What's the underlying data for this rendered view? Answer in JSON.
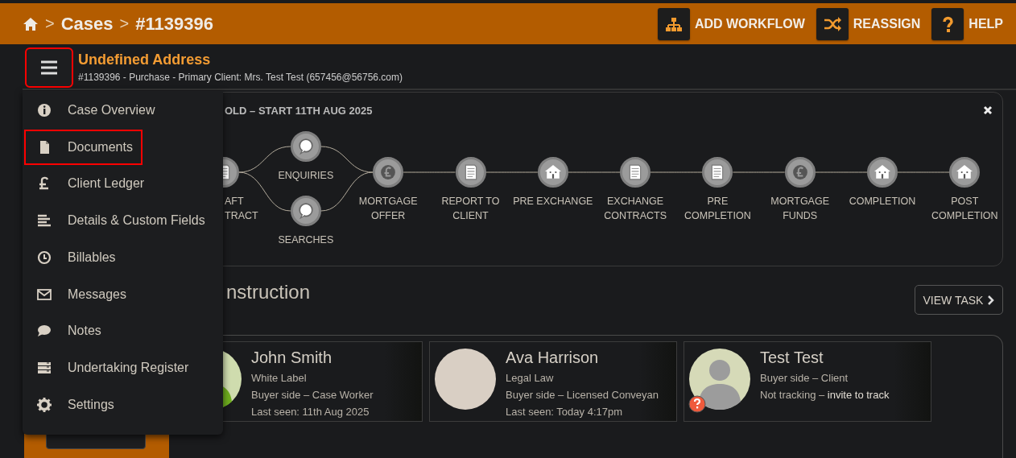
{
  "top_bar": {
    "breadcrumb": {
      "separator": ">",
      "items": [
        "Cases",
        "#1139396"
      ]
    },
    "actions": [
      {
        "label": "ADD WORKFLOW",
        "kind": "workflow"
      },
      {
        "label": "REASSIGN",
        "kind": "shuffle"
      },
      {
        "label": "HELP",
        "kind": "help"
      }
    ]
  },
  "case_header": {
    "menu_button_highlighted": true,
    "title": "Undefined Address",
    "subtitle": "#1139396 - Purchase - Primary Client: Mrs. Test Test (657456@56756.com)"
  },
  "workflow": {
    "title": "OLD – START 11TH AUG 2025",
    "stages": [
      {
        "steps": [
          {
            "label": "AFT TRACT",
            "kind": "document"
          }
        ]
      },
      {
        "steps": [
          {
            "label": "ENQUIRIES",
            "kind": "chat"
          },
          {
            "label": "SEARCHES",
            "kind": "chat"
          }
        ]
      },
      {
        "steps": [
          {
            "label": "MORTGAGE OFFER",
            "kind": "pound"
          }
        ]
      },
      {
        "steps": [
          {
            "label": "REPORT TO CLIENT",
            "kind": "document"
          }
        ]
      },
      {
        "steps": [
          {
            "label": "PRE EXCHANGE",
            "kind": "house"
          }
        ]
      },
      {
        "steps": [
          {
            "label": "EXCHANGE CONTRACTS",
            "kind": "document"
          }
        ]
      },
      {
        "steps": [
          {
            "label": "PRE COMPLETION",
            "kind": "document"
          }
        ]
      },
      {
        "steps": [
          {
            "label": "MORTGAGE FUNDS",
            "kind": "pound"
          }
        ]
      },
      {
        "steps": [
          {
            "label": "COMPLETION",
            "kind": "house"
          }
        ]
      },
      {
        "steps": [
          {
            "label": "POST COMPLETION",
            "kind": "house"
          }
        ]
      }
    ]
  },
  "next_task": {
    "title": "nstruction",
    "button": "VIEW TASK"
  },
  "people": {
    "cards": [
      {
        "name": "John Smith",
        "kind": "silhouette-green",
        "lines": [
          "White Label",
          "Buyer side – Case Worker",
          "Last seen: 11th Aug 2025"
        ]
      },
      {
        "name": "Ava Harrison",
        "kind": "photo",
        "lines": [
          "Legal Law",
          "Buyer side – Licensed Conveyan",
          "Last seen: Today 4:17pm"
        ]
      },
      {
        "name": "Test Test",
        "kind": "silhouette-grey",
        "unverified": true,
        "lines": [
          "Buyer side – Client"
        ],
        "status": "Not tracking –",
        "link": "invite to track"
      }
    ]
  },
  "side_menu": {
    "items": [
      {
        "label": "Case Overview",
        "kind": "info",
        "highlighted": false
      },
      {
        "label": "Documents",
        "kind": "file",
        "highlighted": true
      },
      {
        "label": "Client Ledger",
        "kind": "pound",
        "highlighted": false
      },
      {
        "label": "Details & Custom Fields",
        "kind": "lines",
        "highlighted": false
      },
      {
        "label": "Billables",
        "kind": "clock",
        "highlighted": false
      },
      {
        "label": "Messages",
        "kind": "envelope",
        "highlighted": false
      },
      {
        "label": "Notes",
        "kind": "comment",
        "highlighted": false
      },
      {
        "label": "Undertaking Register",
        "kind": "register",
        "highlighted": false
      },
      {
        "label": "Settings",
        "kind": "gear",
        "highlighted": false
      }
    ]
  }
}
